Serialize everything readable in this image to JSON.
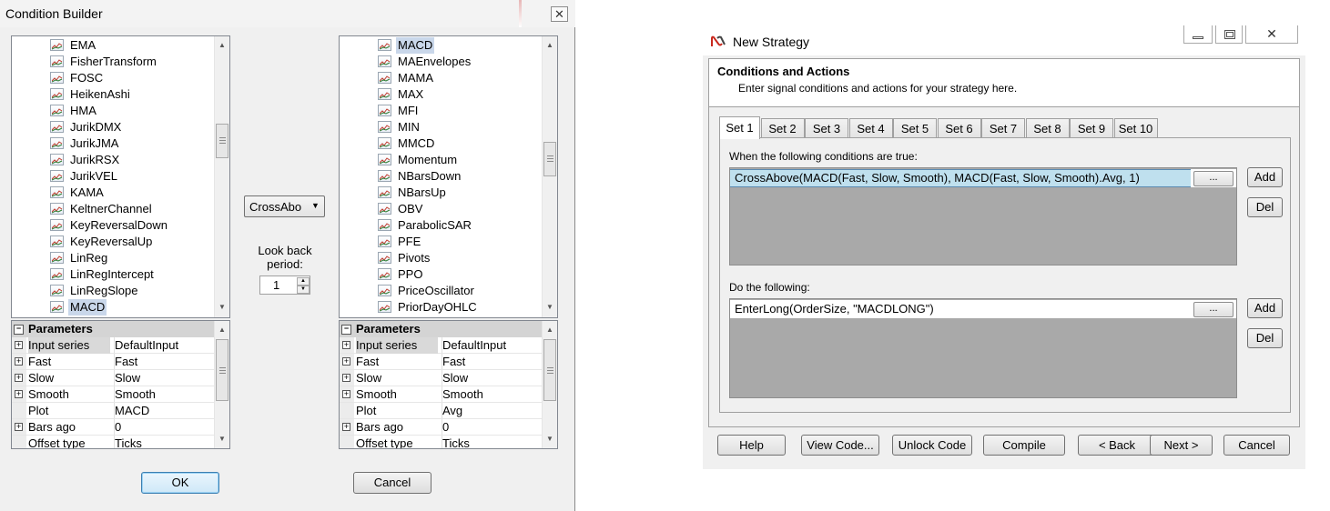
{
  "condition_builder": {
    "title": "Condition Builder",
    "left_list": {
      "items": [
        "EMA",
        "FisherTransform",
        "FOSC",
        "HeikenAshi",
        "HMA",
        "JurikDMX",
        "JurikJMA",
        "JurikRSX",
        "JurikVEL",
        "KAMA",
        "KeltnerChannel",
        "KeyReversalDown",
        "KeyReversalUp",
        "LinReg",
        "LinRegIntercept",
        "LinRegSlope",
        "MACD"
      ],
      "selected": "MACD"
    },
    "right_list": {
      "items": [
        "MACD",
        "MAEnvelopes",
        "MAMA",
        "MAX",
        "MFI",
        "MIN",
        "MMCD",
        "Momentum",
        "NBarsDown",
        "NBarsUp",
        "OBV",
        "ParabolicSAR",
        "PFE",
        "Pivots",
        "PPO",
        "PriceOscillator",
        "PriorDayOHLC"
      ],
      "selected": "MACD"
    },
    "operator_dropdown": "CrossAbo",
    "look_back_label_1": "Look back",
    "look_back_label_2": "period:",
    "look_back_value": "1",
    "left_params": {
      "header": "Parameters",
      "rows": [
        {
          "name": "Input series",
          "value": "DefaultInput",
          "expand": "+"
        },
        {
          "name": "Fast",
          "value": "Fast",
          "expand": "+"
        },
        {
          "name": "Slow",
          "value": "Slow",
          "expand": "+"
        },
        {
          "name": "Smooth",
          "value": "Smooth",
          "expand": "+"
        },
        {
          "name": "Plot",
          "value": "MACD",
          "expand": ""
        },
        {
          "name": "Bars ago",
          "value": "0",
          "expand": "+"
        },
        {
          "name": "Offset type",
          "value": "Ticks",
          "expand": ""
        }
      ]
    },
    "right_params": {
      "header": "Parameters",
      "rows": [
        {
          "name": "Input series",
          "value": "DefaultInput",
          "expand": "+"
        },
        {
          "name": "Fast",
          "value": "Fast",
          "expand": "+"
        },
        {
          "name": "Slow",
          "value": "Slow",
          "expand": "+"
        },
        {
          "name": "Smooth",
          "value": "Smooth",
          "expand": "+"
        },
        {
          "name": "Plot",
          "value": "Avg",
          "expand": ""
        },
        {
          "name": "Bars ago",
          "value": "0",
          "expand": "+"
        },
        {
          "name": "Offset type",
          "value": "Ticks",
          "expand": ""
        }
      ]
    },
    "ok_label": "OK",
    "cancel_label": "Cancel",
    "close_glyph": "✕"
  },
  "new_strategy": {
    "title": "New Strategy",
    "header_title": "Conditions and Actions",
    "header_subtitle": "Enter signal conditions and actions for your strategy here.",
    "tabs": [
      "Set 1",
      "Set 2",
      "Set 3",
      "Set 4",
      "Set 5",
      "Set 6",
      "Set 7",
      "Set 8",
      "Set 9",
      "Set 10"
    ],
    "active_tab": "Set 1",
    "conditions_label": "When the following conditions are true:",
    "conditions": [
      "CrossAbove(MACD(Fast, Slow, Smooth), MACD(Fast, Slow, Smooth).Avg, 1)"
    ],
    "actions_label": "Do the following:",
    "actions": [
      "EnterLong(OrderSize, \"MACDLONG\")"
    ],
    "dots_label": "...",
    "add_label": "Add",
    "del_label": "Del",
    "footer_buttons": {
      "help": "Help",
      "view_code": "View Code...",
      "unlock_code": "Unlock Code",
      "compile": "Compile",
      "back": "< Back",
      "next": "Next >",
      "cancel": "Cancel"
    },
    "min_glyph": "▭",
    "max_glyph": "▣",
    "close_glyph": "✕"
  },
  "colors": {
    "selection_row": "#bfe0ee",
    "grid_bg": "#a9a9a9",
    "logo_red": "#c8281e"
  }
}
